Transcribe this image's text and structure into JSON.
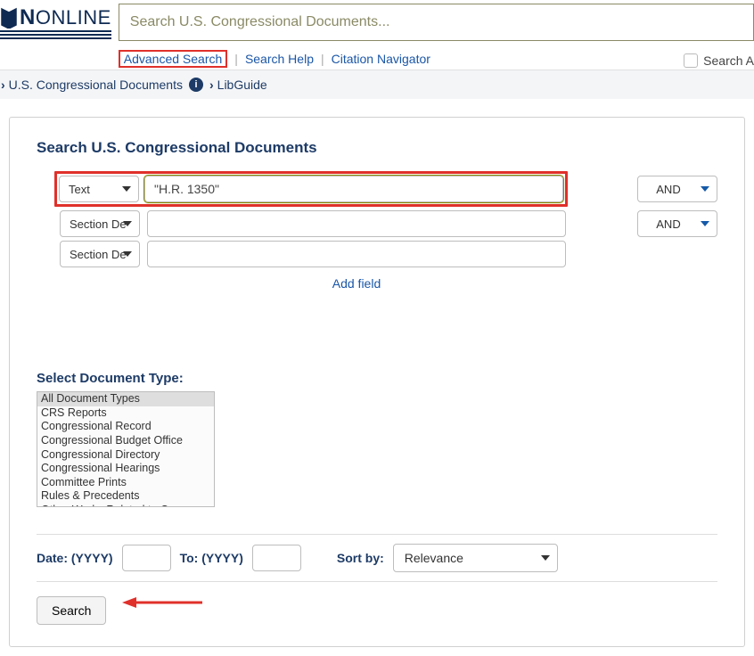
{
  "logo": {
    "letter": "N",
    "rest": "ONLINE"
  },
  "search": {
    "placeholder": "Search U.S. Congressional Documents..."
  },
  "sublinks": {
    "advanced": "Advanced Search",
    "help": "Search Help",
    "citation": "Citation Navigator",
    "search_a": "Search A"
  },
  "breadcrumbs": {
    "item1": "U.S. Congressional Documents",
    "item2": "LibGuide"
  },
  "panel": {
    "title": "Search U.S. Congressional Documents",
    "row1": {
      "field": "Text",
      "value": "\"H.R. 1350\"",
      "op": "AND"
    },
    "row2": {
      "field": "Section De",
      "value": "",
      "op": "AND"
    },
    "row3": {
      "field": "Section De",
      "value": ""
    },
    "add_field": "Add field",
    "doc_type_label": "Select Document Type:",
    "doc_types": [
      "All Document Types",
      "CRS Reports",
      "Congressional Record",
      "Congressional Budget Office",
      "Congressional Directory",
      "Congressional Hearings",
      "Committee Prints",
      "Rules & Precedents",
      "Other Works Related to Congress"
    ],
    "date_from_lbl": "Date: (YYYY)",
    "date_to_lbl": "To: (YYYY)",
    "sort_lbl": "Sort by:",
    "sort_value": "Relevance",
    "search_btn": "Search"
  }
}
